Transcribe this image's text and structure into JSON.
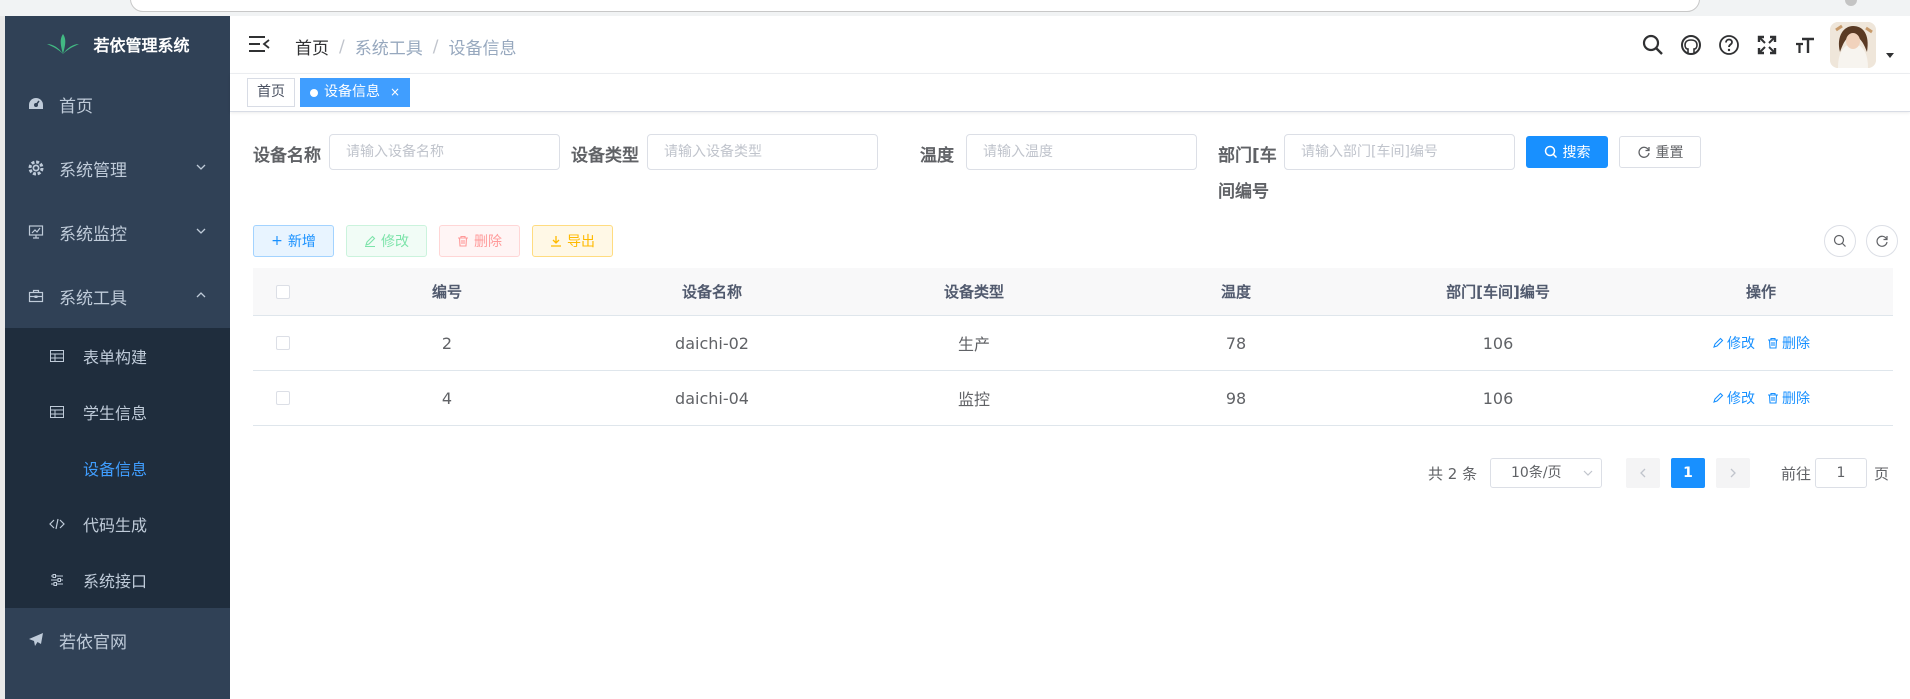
{
  "app": {
    "title": "若依管理系统"
  },
  "sidebar": {
    "items": [
      {
        "label": "首页",
        "icon": "dashboard-icon"
      },
      {
        "label": "系统管理",
        "icon": "gear-icon"
      },
      {
        "label": "系统监控",
        "icon": "monitor-icon"
      },
      {
        "label": "系统工具",
        "icon": "toolbox-icon"
      }
    ],
    "subitems": [
      {
        "label": "表单构建",
        "icon": "table-icon"
      },
      {
        "label": "学生信息",
        "icon": "table-icon"
      },
      {
        "label": "设备信息"
      },
      {
        "label": "代码生成",
        "icon": "code-icon"
      },
      {
        "label": "系统接口",
        "icon": "sliders-icon"
      }
    ],
    "bottom": {
      "label": "若依官网",
      "icon": "paper-plane-icon"
    }
  },
  "breadcrumb": [
    "首页",
    "系统工具",
    "设备信息"
  ],
  "tags": [
    {
      "label": "首页",
      "active": false
    },
    {
      "label": "设备信息",
      "active": true,
      "close": "×"
    }
  ],
  "search": {
    "fields": [
      {
        "label": "设备名称",
        "placeholder": "请输入设备名称"
      },
      {
        "label": "设备类型",
        "placeholder": "请输入设备类型"
      },
      {
        "label": "温度",
        "placeholder": "请输入温度"
      },
      {
        "label_line1": "部门[车",
        "label_line2": "间编号",
        "placeholder": "请输入部门[车间]编号"
      }
    ],
    "search_button": "搜索",
    "reset_button": "重置"
  },
  "toolbar": {
    "add": "新增",
    "edit": "修改",
    "delete": "删除",
    "export": "导出"
  },
  "table": {
    "headers": [
      "编号",
      "设备名称",
      "设备类型",
      "温度",
      "部门[车间]编号",
      "操作"
    ],
    "rows": [
      {
        "id": "2",
        "name": "daichi-02",
        "type": "生产",
        "temp": "78",
        "dept": "106"
      },
      {
        "id": "4",
        "name": "daichi-04",
        "type": "监控",
        "temp": "98",
        "dept": "106"
      }
    ],
    "op_edit": "修改",
    "op_delete": "删除"
  },
  "pagination": {
    "total": "共 2 条",
    "page_size": "10条/页",
    "current": "1",
    "goto_label": "前往",
    "goto_value": "1",
    "page_suffix": "页"
  },
  "colors": {
    "sidebar_bg": "#304156",
    "submenu_bg": "#1f2d3d",
    "primary": "#1890ff",
    "active_text": "#409eff"
  }
}
